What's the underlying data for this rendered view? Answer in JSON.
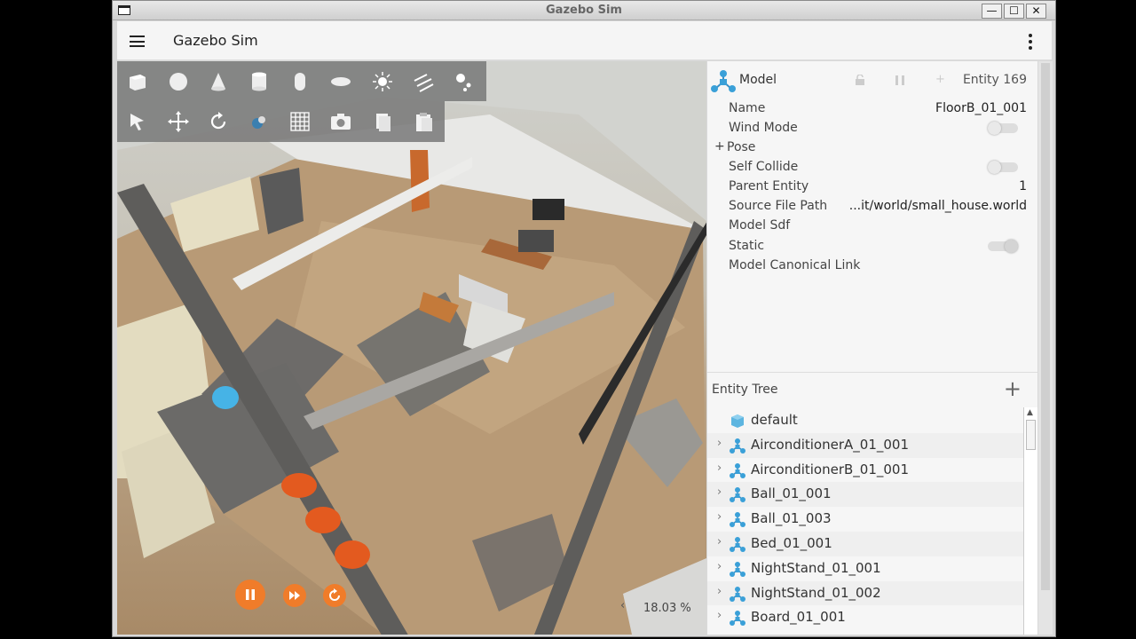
{
  "window": {
    "title": "Gazebo Sim",
    "buttons": {
      "minimize": "—",
      "maximize": "☐",
      "close": "✕"
    }
  },
  "appbar": {
    "title": "Gazebo Sim"
  },
  "viewport": {
    "zoom_label": "18.03 %"
  },
  "component_inspector": {
    "type_label": "Model",
    "entity_label": "Entity 169",
    "properties": [
      {
        "key": "Name",
        "value": "FloorB_01_001"
      },
      {
        "key": "Wind Mode",
        "toggle": false
      },
      {
        "key": "Pose",
        "expander": "+"
      },
      {
        "key": "Self Collide",
        "toggle": false
      },
      {
        "key": "Parent Entity",
        "value": "1"
      },
      {
        "key": "Source File Path",
        "value": "...it/world/small_house.world"
      },
      {
        "key": "Model Sdf",
        "value": ""
      },
      {
        "key": "Static",
        "toggle": true
      },
      {
        "key": "Model Canonical Link",
        "value": ""
      }
    ]
  },
  "entity_tree": {
    "title": "Entity Tree",
    "add_label": "+",
    "items": [
      {
        "label": "default",
        "icon": "world-icon"
      },
      {
        "label": "AirconditionerA_01_001",
        "icon": "model-icon"
      },
      {
        "label": "AirconditionerB_01_001",
        "icon": "model-icon"
      },
      {
        "label": "Ball_01_001",
        "icon": "model-icon"
      },
      {
        "label": "Ball_01_003",
        "icon": "model-icon"
      },
      {
        "label": "Bed_01_001",
        "icon": "model-icon"
      },
      {
        "label": "NightStand_01_001",
        "icon": "model-icon"
      },
      {
        "label": "NightStand_01_002",
        "icon": "model-icon"
      },
      {
        "label": "Board_01_001",
        "icon": "model-icon"
      }
    ]
  },
  "colors": {
    "accent": "#f07c2a",
    "entity_icon": "#3aa0d8",
    "toolbar_bg": "#787878"
  }
}
